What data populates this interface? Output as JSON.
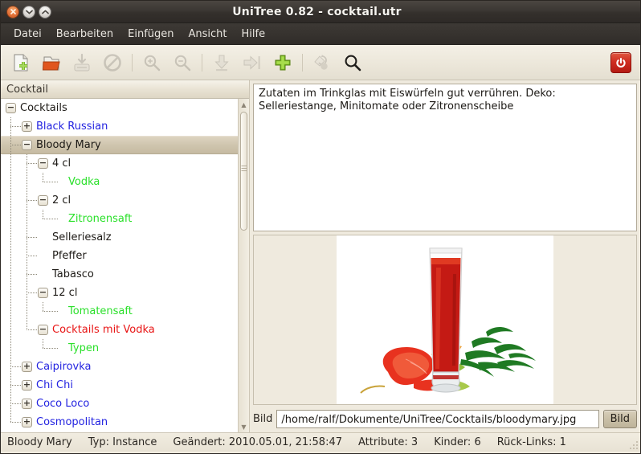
{
  "window": {
    "title": "UniTree 0.82 - cocktail.utr",
    "controls": [
      {
        "name": "close-button",
        "glyph": "✕"
      },
      {
        "name": "minimize-button",
        "glyph": "⌄"
      },
      {
        "name": "maximize-button",
        "glyph": "⌃"
      }
    ]
  },
  "menubar": {
    "items": [
      "Datei",
      "Bearbeiten",
      "Einfügen",
      "Ansicht",
      "Hilfe"
    ]
  },
  "toolbar": {
    "buttons": [
      {
        "name": "new-document-button",
        "icon": "new-document-icon",
        "enabled": true
      },
      {
        "name": "open-folder-button",
        "icon": "open-folder-icon",
        "enabled": true
      },
      {
        "name": "save-button",
        "icon": "save-disk-icon",
        "enabled": false
      },
      {
        "name": "cancel-button",
        "icon": "no-entry-icon",
        "enabled": false
      },
      {
        "name": "zoom-in-button",
        "icon": "magnifier-plus-icon",
        "enabled": false
      },
      {
        "name": "zoom-out-button",
        "icon": "magnifier-minus-icon",
        "enabled": false
      },
      {
        "name": "move-down-button",
        "icon": "arrow-down-icon",
        "enabled": false
      },
      {
        "name": "move-right-button",
        "icon": "arrow-right-bar-icon",
        "enabled": false
      },
      {
        "name": "add-node-button",
        "icon": "green-plus-icon",
        "enabled": true
      },
      {
        "name": "color-refresh-button",
        "icon": "paint-refresh-icon",
        "enabled": false
      },
      {
        "name": "search-button",
        "icon": "magnifier-icon",
        "enabled": true
      }
    ],
    "quit_button": {
      "name": "quit-button",
      "icon": "power-icon"
    }
  },
  "tree": {
    "header": "Cocktail",
    "rows": [
      {
        "label": "Cocktails",
        "depth": 0,
        "expander": "minus",
        "color": "black",
        "selected": false
      },
      {
        "label": "Black Russian",
        "depth": 1,
        "expander": "plus",
        "color": "blue",
        "selected": false
      },
      {
        "label": "Bloody Mary",
        "depth": 1,
        "expander": "minus",
        "color": "black",
        "selected": true
      },
      {
        "label": "4 cl",
        "depth": 2,
        "expander": "minus",
        "color": "black",
        "selected": false
      },
      {
        "label": "Vodka",
        "depth": 3,
        "expander": "none",
        "color": "green",
        "selected": false
      },
      {
        "label": "2 cl",
        "depth": 2,
        "expander": "minus",
        "color": "black",
        "selected": false
      },
      {
        "label": "Zitronensaft",
        "depth": 3,
        "expander": "none",
        "color": "green",
        "selected": false
      },
      {
        "label": "Selleriesalz",
        "depth": 2,
        "expander": "none",
        "color": "black",
        "selected": false
      },
      {
        "label": "Pfeffer",
        "depth": 2,
        "expander": "none",
        "color": "black",
        "selected": false
      },
      {
        "label": "Tabasco",
        "depth": 2,
        "expander": "none",
        "color": "black",
        "selected": false
      },
      {
        "label": "12 cl",
        "depth": 2,
        "expander": "minus",
        "color": "black",
        "selected": false
      },
      {
        "label": "Tomatensaft",
        "depth": 3,
        "expander": "none",
        "color": "green",
        "selected": false
      },
      {
        "label": "Cocktails mit Vodka",
        "depth": 2,
        "expander": "minus",
        "color": "red",
        "selected": false
      },
      {
        "label": "Typen",
        "depth": 3,
        "expander": "none",
        "color": "green",
        "selected": false
      },
      {
        "label": "Caipirovka",
        "depth": 1,
        "expander": "plus",
        "color": "blue",
        "selected": false
      },
      {
        "label": "Chi Chi",
        "depth": 1,
        "expander": "plus",
        "color": "blue",
        "selected": false
      },
      {
        "label": "Coco Loco",
        "depth": 1,
        "expander": "plus",
        "color": "blue",
        "selected": false
      },
      {
        "label": "Cosmopolitan",
        "depth": 1,
        "expander": "plus",
        "color": "blue",
        "selected": false
      }
    ]
  },
  "detail": {
    "description": "Zutaten im Trinkglas mit Eiswürfeln gut verrühren. Deko: Selleriestange, Minitomate oder Zitronenscheibe",
    "image_alt": "bloody-mary-cocktail-photo",
    "path_label": "Bild",
    "path_value": "/home/ralf/Dokumente/UniTree/Cocktails/bloodymary.jpg",
    "path_button": "Bild"
  },
  "statusbar": {
    "node_name": "Bloody Mary",
    "type": "Typ: Instance",
    "modified": "Geändert: 2010.05.01, 21:58:47",
    "attribute": "Attribute: 3",
    "children": "Kinder: 6",
    "backlinks": "Rück-Links: 1"
  },
  "colors": {
    "title_bg": "#3b3733",
    "toolbar_bg": "#ece7da",
    "selection": "#cfc5ae",
    "link_blue": "#2323e0",
    "leaf_green": "#2ae02a",
    "node_red": "#e81414",
    "quit_red": "#cf2f22"
  }
}
